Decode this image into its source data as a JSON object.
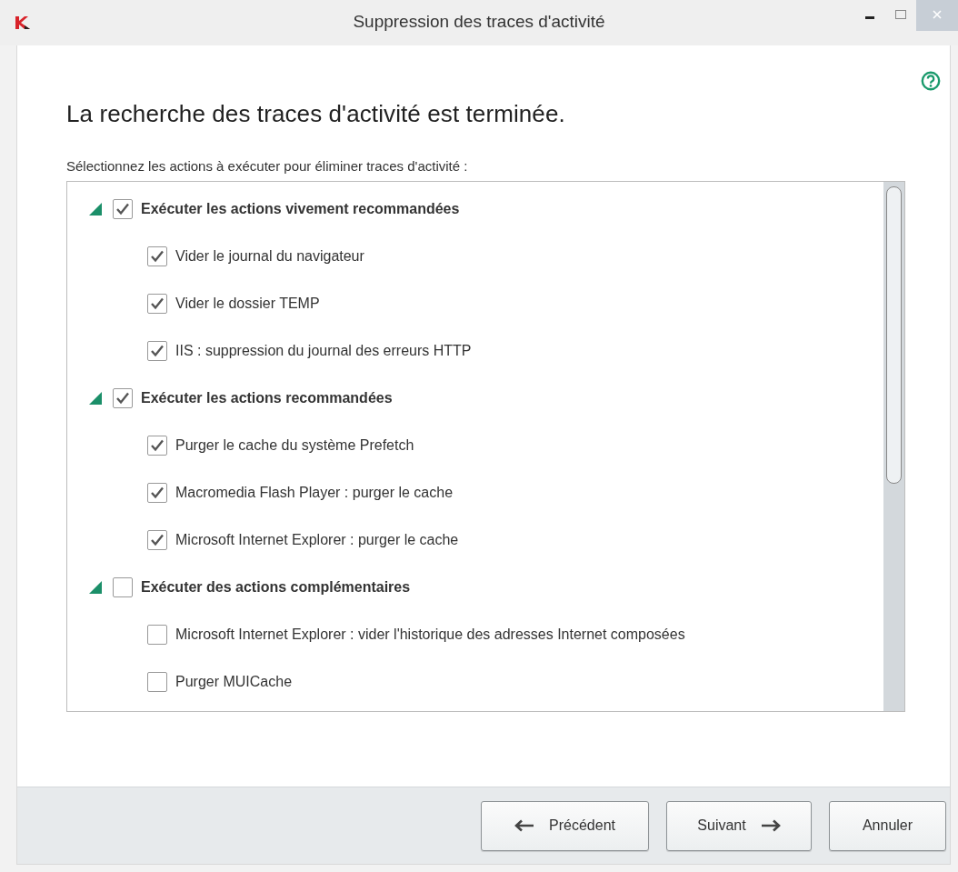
{
  "window": {
    "title": "Suppression des traces d'activité"
  },
  "heading": "La recherche des traces d'activité est terminée.",
  "instruction": "Sélectionnez les actions à exécuter pour éliminer traces d'activité :",
  "tree": [
    {
      "label": "Exécuter les actions vivement recommandées",
      "checked": true,
      "expanded": true,
      "children": [
        {
          "label": "Vider le journal du navigateur",
          "checked": true
        },
        {
          "label": "Vider le dossier TEMP",
          "checked": true
        },
        {
          "label": "IIS : suppression du journal des erreurs HTTP",
          "checked": true
        }
      ]
    },
    {
      "label": "Exécuter les actions recommandées",
      "checked": true,
      "expanded": true,
      "children": [
        {
          "label": "Purger le cache du système Prefetch",
          "checked": true
        },
        {
          "label": "Macromedia Flash Player : purger le cache",
          "checked": true
        },
        {
          "label": "Microsoft Internet Explorer : purger le cache",
          "checked": true
        }
      ]
    },
    {
      "label": "Exécuter des actions complémentaires",
      "checked": false,
      "expanded": true,
      "children": [
        {
          "label": "Microsoft Internet Explorer : vider l'historique des adresses Internet composées",
          "checked": false
        },
        {
          "label": "Purger MUICache",
          "checked": false
        }
      ]
    }
  ],
  "buttons": [
    {
      "label": "Précédent",
      "kind": "back"
    },
    {
      "label": "Suivant",
      "kind": "next"
    },
    {
      "label": "Annuler",
      "kind": "plain"
    }
  ]
}
